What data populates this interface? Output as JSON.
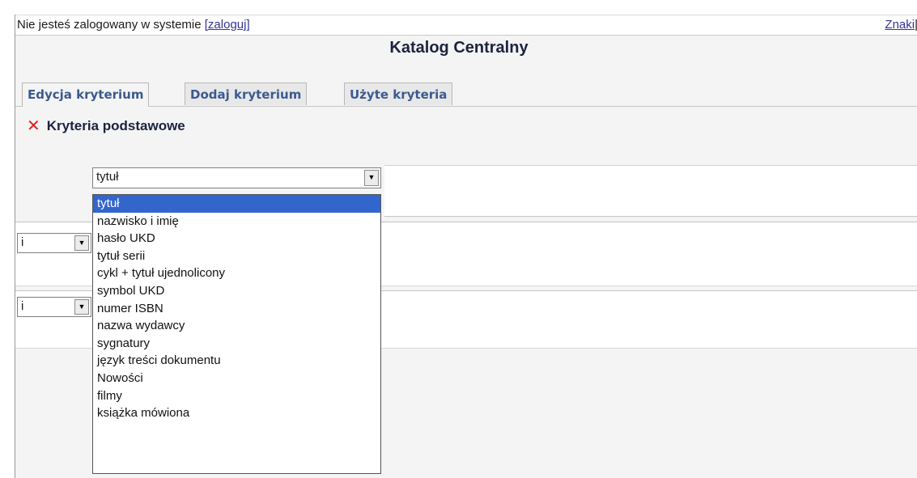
{
  "login_bar": {
    "text": "Nie jesteś zalogowany w systemie ",
    "login_link": "[zaloguj]",
    "right_link": "Znaki",
    "right_sep": "|"
  },
  "title": "Katalog Centralny",
  "tabs": [
    {
      "label": "Edycja kryterium",
      "active": true
    },
    {
      "label": "Dodaj kryterium",
      "active": false
    },
    {
      "label": "Użyte kryteria",
      "active": false
    }
  ],
  "section": {
    "label": "Kryteria podstawowe",
    "remove_icon": "close-x-icon",
    "remove_color": "#e02020"
  },
  "field_select": {
    "value": "tytuł",
    "options": [
      "tytuł",
      "nazwisko i imię",
      "hasło UKD",
      "tytuł serii",
      "cykl + tytuł ujednolicony",
      "symbol UKD",
      "numer ISBN",
      "nazwa wydawcy",
      "sygnatury",
      "język treści dokumentu",
      "Nowości",
      "filmy",
      "książka mówiona"
    ],
    "highlight_color": "#3366cc"
  },
  "operator_selects": [
    {
      "value": "i"
    },
    {
      "value": "i"
    }
  ],
  "select_arrow_glyph": "▼"
}
